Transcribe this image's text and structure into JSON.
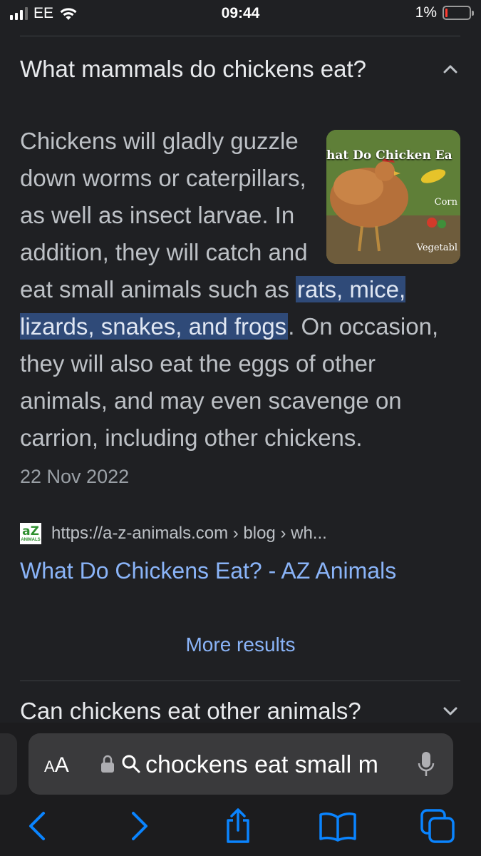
{
  "status_bar": {
    "carrier": "EE",
    "time": "09:44",
    "battery_percent": "1%",
    "signal_bars_active": 3,
    "signal_bars_total": 4,
    "battery_level": 0.01
  },
  "accordion": {
    "question": "What mammals do chickens eat?",
    "expanded": true,
    "answer_before": "Chickens will gladly guzzle down worms or caterpillars, as well as insect larvae. In addition, they will catch and eat small animals such as ",
    "answer_highlight": "rats, mice, lizards, snakes, and frogs",
    "answer_after": ". On occasion, they will also eat the eggs of other animals, and may even scavenge on carrion, including other chickens.",
    "date": "22 Nov 2022",
    "thumbnail": {
      "title": "hat Do Chicken Ea",
      "label_corn": "Corn",
      "label_veg": "Vegetabl"
    }
  },
  "source": {
    "favicon_text": "aZ",
    "favicon_subtext": "ANIMALS",
    "url": "https://a-z-animals.com › blog › wh...",
    "title": "What Do Chickens Eat? - AZ Animals"
  },
  "more_results": "More results",
  "next_question": "Can chickens eat other animals?",
  "safari": {
    "aa_small": "A",
    "aa_large": "A",
    "address_text": "chockens eat small m",
    "icons": [
      "lock-icon",
      "magnifier-icon",
      "microphone-icon",
      "back-icon",
      "forward-icon",
      "share-icon",
      "bookmarks-icon",
      "tabs-icon"
    ]
  },
  "colors": {
    "background": "#1f2023",
    "link": "#8ab4f8",
    "highlight": "#2f4a78",
    "safari_blue": "#0a84ff"
  }
}
